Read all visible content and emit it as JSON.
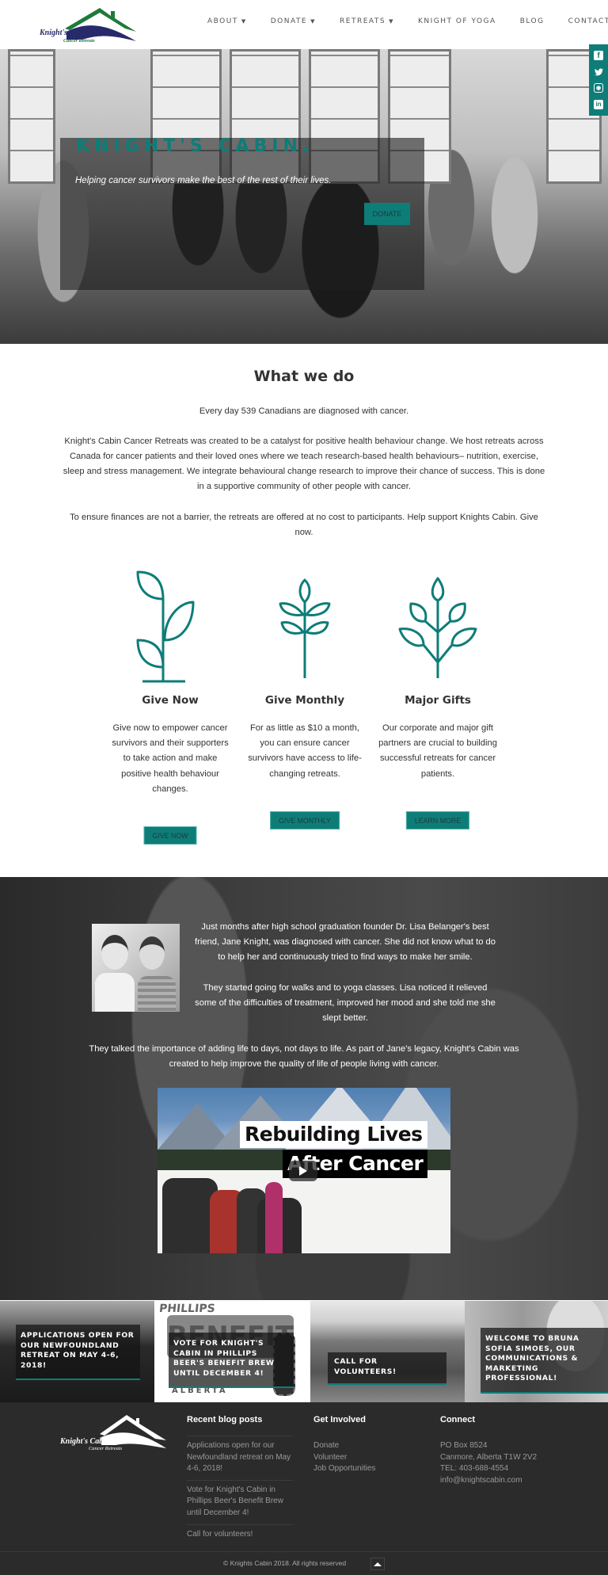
{
  "header": {
    "logo": {
      "name": "Knight's Cabin",
      "tagline": "Cancer Retreats"
    },
    "nav": [
      {
        "label": "ABOUT",
        "dropdown": true
      },
      {
        "label": "DONATE",
        "dropdown": true
      },
      {
        "label": "RETREATS",
        "dropdown": true
      },
      {
        "label": "KNIGHT OF YOGA",
        "dropdown": false
      },
      {
        "label": "BLOG",
        "dropdown": false
      },
      {
        "label": "CONTACT",
        "dropdown": false
      }
    ],
    "caret": "▼"
  },
  "social": [
    {
      "icon": "facebook-icon",
      "glyph": "f"
    },
    {
      "icon": "twitter-icon",
      "glyph": "🐦"
    },
    {
      "icon": "instagram-icon",
      "glyph": "◉"
    },
    {
      "icon": "linkedin-icon",
      "glyph": "in"
    }
  ],
  "hero": {
    "title": "KNIGHT'S CABIN.",
    "subtitle": "Helping cancer survivors make the best of the rest of their lives.",
    "button": "DONATE"
  },
  "what_we_do": {
    "title": "What we do",
    "paragraphs": [
      "Every day 539 Canadians are diagnosed with cancer.",
      "Knight's Cabin Cancer Retreats was created to be a catalyst for positive health behaviour change. We host retreats across Canada for cancer patients and their loved ones where we teach research-based health behaviours– nutrition, exercise, sleep and stress management. We integrate behavioural change research to improve their chance of success. This is done in a supportive community of other people with cancer.",
      "To ensure finances are not a barrier, the retreats are offered at no cost to participants. Help support Knights Cabin. Give now."
    ]
  },
  "give": [
    {
      "title": "Give Now",
      "text": "Give now to empower cancer survivors and their supporters to take action and make positive health behaviour changes.",
      "button": "GIVE NOW"
    },
    {
      "title": "Give Monthly",
      "text": "For as little as $10 a month, you can ensure cancer survivors have access to life-changing retreats.",
      "button": "GIVE MONTHLY"
    },
    {
      "title": "Major Gifts",
      "text": "Our corporate and major gift partners are crucial to building successful retreats for cancer patients.",
      "button": "LEARN MORE"
    }
  ],
  "story": {
    "p1": "Just months after high school graduation founder Dr. Lisa Belanger's best friend, Jane Knight, was diagnosed with cancer. She did not know what to do to help her and continuously tried to find ways to make her smile.",
    "p2": "They started going for walks and to yoga classes. Lisa noticed it relieved some of the difficulties of treatment, improved her mood and she told me she slept better.",
    "p3": "They talked the importance of adding life to days, not days to life. As part of Jane's legacy, Knight's Cabin was created to help improve the quality of life of people living with cancer.",
    "video": {
      "line1": "Rebuilding Lives",
      "line2": "After Cancer"
    }
  },
  "tiles": [
    {
      "caption": "APPLICATIONS OPEN FOR OUR NEWFOUNDLAND RETREAT ON MAY 4-6, 2018!"
    },
    {
      "caption": "VOTE FOR KNIGHT'S CABIN IN PHILLIPS BEER'S BENEFIT BREW UNTIL DECEMBER 4!",
      "art_top": "PHILLIPS",
      "art_mid": "BENEFIT",
      "art_bottom": "ALBERTA"
    },
    {
      "caption": "CALL FOR VOLUNTEERS!"
    },
    {
      "caption": "WELCOME TO BRUNA SOFIA SIMOES, OUR COMMUNICATIONS & MARKETING PROFESSIONAL!"
    }
  ],
  "footer": {
    "logo": {
      "name": "Knight's Cabin",
      "tagline": "Cancer Retreats"
    },
    "recent": {
      "title": "Recent blog posts",
      "posts": [
        "Applications open for our Newfoundland retreat on May 4-6, 2018!",
        "Vote for Knight's Cabin in Phillips Beer's Benefit Brew until December 4!",
        "Call for volunteers!"
      ]
    },
    "involved": {
      "title": "Get Involved",
      "links": [
        "Donate",
        "Volunteer",
        "Job Opportunities"
      ]
    },
    "connect": {
      "title": "Connect",
      "lines": [
        "PO Box 8524",
        "Canmore, Alberta T1W 2V2",
        "TEL: 403-688-4554",
        "info@knightscabin.com"
      ]
    },
    "copyright": "© Knights Cabin 2018. All rights reserved"
  },
  "colors": {
    "accent": "#0e7d78",
    "footer_bg": "#2b2b2b",
    "text": "#333333"
  }
}
